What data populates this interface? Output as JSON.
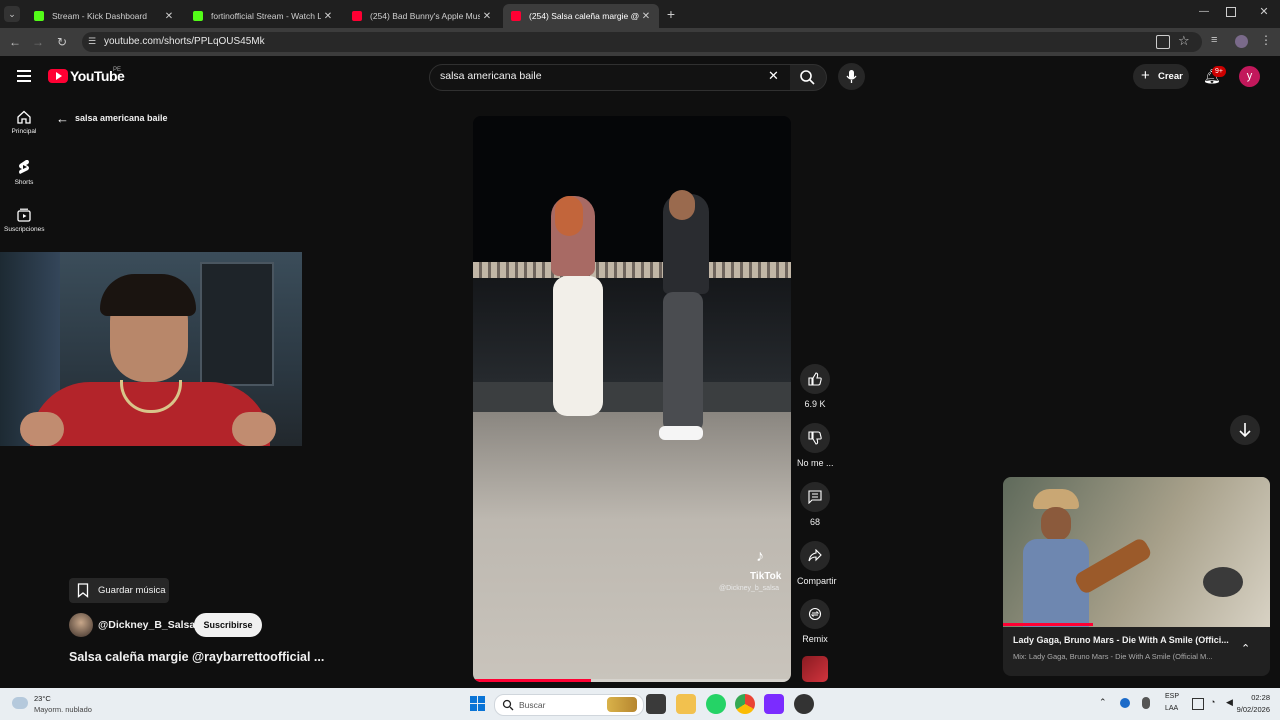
{
  "browser": {
    "tabs": [
      {
        "title": "Stream - Kick Dashboard",
        "favicon_color": "#53fc18",
        "active": false
      },
      {
        "title": "fortinofficial Stream - Watch Liv",
        "favicon_color": "#53fc18",
        "active": false
      },
      {
        "title": "(254) Bad Bunny's Apple Music",
        "favicon_color": "#ff0033",
        "active": false
      },
      {
        "title": "(254) Salsa caleña margie @ray",
        "favicon_color": "#ff0033",
        "active": true
      }
    ],
    "url": "youtube.com/shorts/PPLqOUS45Mk"
  },
  "youtube": {
    "logo_text": "YouTube",
    "country": "PE",
    "search_value": "salsa americana baile",
    "create_label": "Crear",
    "notif_count": "9+",
    "avatar_letter": "y",
    "sidebar": [
      {
        "label": "Principal",
        "icon": "home-icon"
      },
      {
        "label": "Shorts",
        "icon": "shorts-icon"
      },
      {
        "label": "Suscripciones",
        "icon": "subscriptions-icon"
      }
    ],
    "back_query": "salsa americana baile",
    "save_music_label": "Guardar música",
    "channel_name": "@Dickney_B_Salsa",
    "subscribe_label": "Suscribirse",
    "short_title": "Salsa caleña margie @raybarrettoofficial ...",
    "video_watermark": "TikTok",
    "video_handle": "@Dickney_b_salsa",
    "actions": {
      "likes": "6.9 K",
      "dislike": "No me ...",
      "comments": "68",
      "share": "Compartir",
      "remix": "Remix"
    },
    "progress_fraction": 0.37,
    "miniplayer": {
      "title": "Lady Gaga, Bruno Mars - Die With A Smile (Offici...",
      "subtitle": "Mix: Lady Gaga, Bruno Mars - Die With A Smile (Official M..."
    }
  },
  "taskbar": {
    "weather_temp": "23°C",
    "weather_desc": "Mayorm. nublado",
    "search_placeholder": "Buscar",
    "lang_top": "ESP",
    "lang_bottom": "LAA",
    "time": "02:28",
    "date": "9/02/2026"
  },
  "colors": {
    "bg": "#0f0f0f",
    "accent_red": "#ff0033",
    "kick_green": "#53fc18",
    "avatar": "#c2185b"
  }
}
